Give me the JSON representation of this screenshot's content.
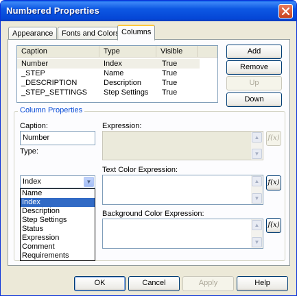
{
  "window": {
    "title": "Numbered Properties"
  },
  "tabs": [
    {
      "label": "Appearance"
    },
    {
      "label": "Fonts and Colors"
    },
    {
      "label": "Columns"
    }
  ],
  "columns_list": {
    "headers": [
      "Caption",
      "Type",
      "Visible"
    ],
    "rows": [
      {
        "caption": "Number",
        "type": "Index",
        "visible": "True"
      },
      {
        "caption": "_STEP",
        "type": "Name",
        "visible": "True"
      },
      {
        "caption": "_DESCRIPTION",
        "type": "Description",
        "visible": "True"
      },
      {
        "caption": "_STEP_SETTINGS",
        "type": "Step Settings",
        "visible": "True"
      }
    ]
  },
  "side_buttons": {
    "add": "Add",
    "remove": "Remove",
    "up": "Up",
    "down": "Down"
  },
  "column_properties": {
    "group_title": "Column Properties",
    "caption_label": "Caption:",
    "caption_value": "Number",
    "type_label": "Type:",
    "type_value": "Index",
    "type_options": [
      "Name",
      "Index",
      "Description",
      "Step Settings",
      "Status",
      "Expression",
      "Comment",
      "Requirements"
    ],
    "type_selected": "Index",
    "expression_label": "Expression:",
    "text_color_label": "Text Color Expression:",
    "bg_color_label": "Background Color Expression:",
    "fx_label": "f(x)"
  },
  "footer_buttons": {
    "ok": "OK",
    "cancel": "Cancel",
    "apply": "Apply",
    "help": "Help"
  }
}
